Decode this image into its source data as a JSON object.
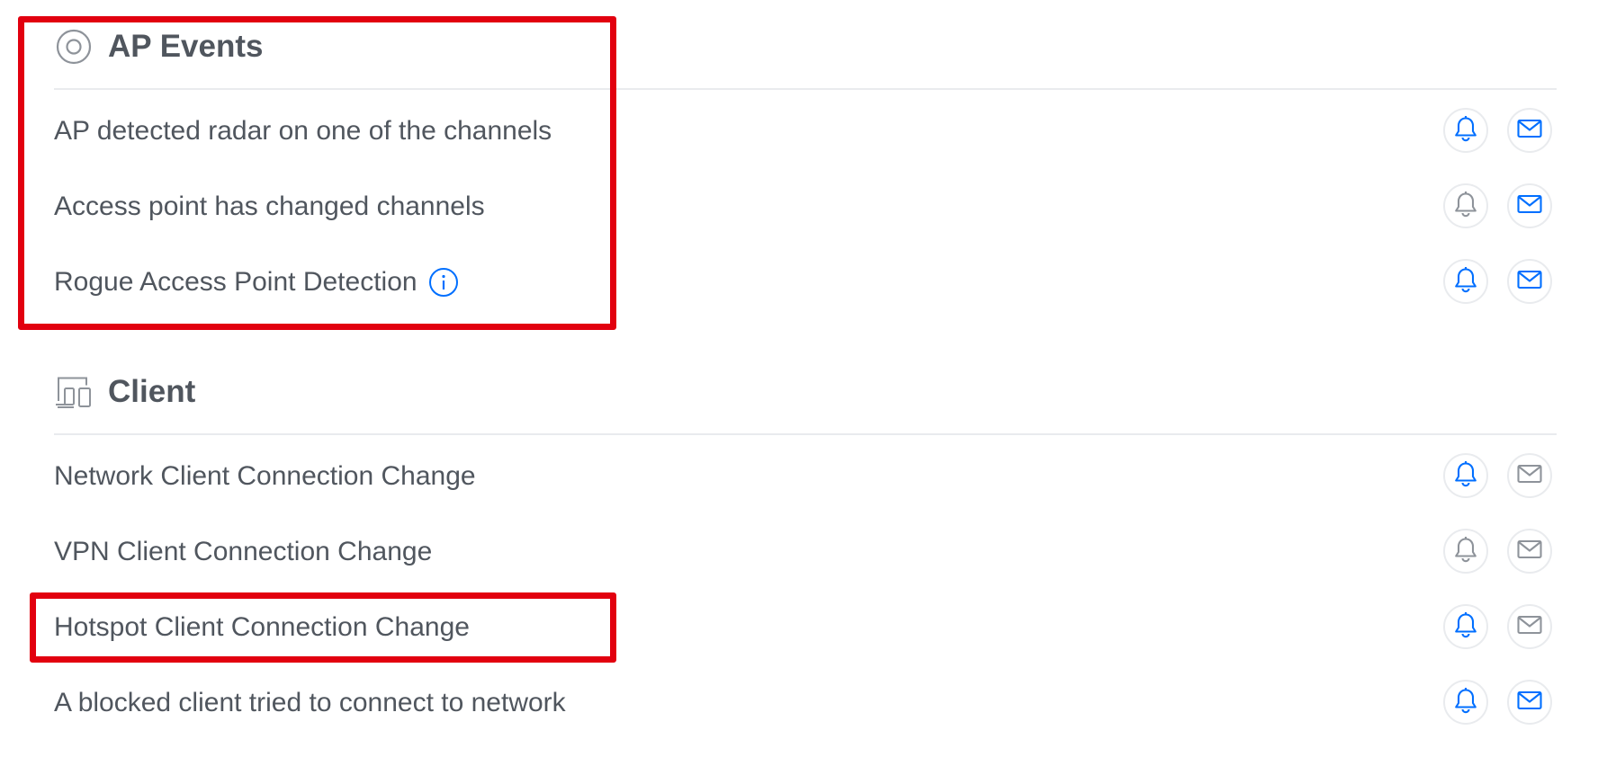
{
  "sections": [
    {
      "title": "AP Events",
      "icon": "radar-target-icon",
      "rows": [
        {
          "label": "AP detected radar on one of the channels",
          "push_enabled": true,
          "email_enabled": true,
          "has_info": false
        },
        {
          "label": "Access point has changed channels",
          "push_enabled": false,
          "email_enabled": true,
          "has_info": false
        },
        {
          "label": "Rogue Access Point Detection",
          "push_enabled": true,
          "email_enabled": true,
          "has_info": true
        }
      ]
    },
    {
      "title": "Client",
      "icon": "client-devices-icon",
      "rows": [
        {
          "label": "Network Client Connection Change",
          "push_enabled": true,
          "email_enabled": false,
          "has_info": false
        },
        {
          "label": "VPN Client Connection Change",
          "push_enabled": false,
          "email_enabled": false,
          "has_info": false
        },
        {
          "label": "Hotspot Client Connection Change",
          "push_enabled": true,
          "email_enabled": false,
          "has_info": false
        },
        {
          "label": "A blocked client tried to connect to network",
          "push_enabled": true,
          "email_enabled": true,
          "has_info": false
        }
      ]
    }
  ],
  "colors": {
    "active": "#006fff",
    "inactive": "#8e939a",
    "text": "#50565e",
    "highlight": "#e2000f"
  },
  "icons": {
    "push": "bell-icon",
    "email": "envelope-icon",
    "info": "info-icon"
  }
}
